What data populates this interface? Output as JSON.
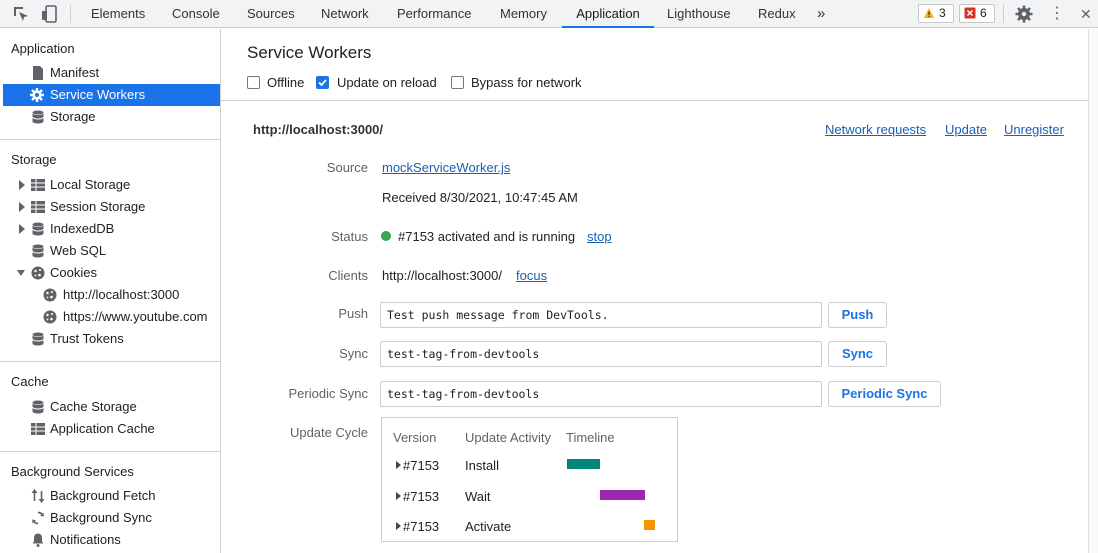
{
  "toolbar": {
    "tabs": [
      "Elements",
      "Console",
      "Sources",
      "Network",
      "Performance",
      "Memory",
      "Application",
      "Lighthouse",
      "Redux"
    ],
    "active_tab": "Application",
    "more_tabs": "»",
    "warnings_count": "3",
    "errors_count": "6",
    "close_glyph": "✕",
    "more_glyph": "⋮"
  },
  "sidebar": {
    "sections": [
      {
        "title": "Application",
        "items": [
          {
            "label": "Manifest",
            "icon": "document-icon"
          },
          {
            "label": "Service Workers",
            "icon": "gear-icon",
            "selected": true
          },
          {
            "label": "Storage",
            "icon": "database-icon"
          }
        ]
      },
      {
        "title": "Storage",
        "items": [
          {
            "label": "Local Storage",
            "icon": "grid-icon",
            "expand": "collapsed"
          },
          {
            "label": "Session Storage",
            "icon": "grid-icon",
            "expand": "collapsed"
          },
          {
            "label": "IndexedDB",
            "icon": "database-icon",
            "expand": "collapsed"
          },
          {
            "label": "Web SQL",
            "icon": "database-icon"
          },
          {
            "label": "Cookies",
            "icon": "cookie-icon",
            "expand": "expanded"
          },
          {
            "label": "http://localhost:3000",
            "icon": "cookie-icon",
            "child": true
          },
          {
            "label": "https://www.youtube.com",
            "icon": "cookie-icon",
            "child": true
          },
          {
            "label": "Trust Tokens",
            "icon": "database-icon"
          }
        ]
      },
      {
        "title": "Cache",
        "items": [
          {
            "label": "Cache Storage",
            "icon": "database-icon"
          },
          {
            "label": "Application Cache",
            "icon": "grid-icon"
          }
        ]
      },
      {
        "title": "Background Services",
        "items": [
          {
            "label": "Background Fetch",
            "icon": "arrows-updown-icon"
          },
          {
            "label": "Background Sync",
            "icon": "sync-icon"
          },
          {
            "label": "Notifications",
            "icon": "bell-icon"
          }
        ]
      }
    ]
  },
  "main": {
    "title": "Service Workers",
    "options": [
      {
        "label": "Offline",
        "checked": false
      },
      {
        "label": "Update on reload",
        "checked": true
      },
      {
        "label": "Bypass for network",
        "checked": false
      }
    ],
    "origin": "http://localhost:3000/",
    "header_links": [
      "Network requests",
      "Update",
      "Unregister"
    ],
    "source_label": "Source",
    "source_file": "mockServiceWorker.js",
    "received": "Received 8/30/2021, 10:47:45 AM",
    "status_label": "Status",
    "status_text": "#7153 activated and is running",
    "status_action": "stop",
    "status_color": "#34a853",
    "clients_label": "Clients",
    "clients_value": "http://localhost:3000/",
    "clients_action": "focus",
    "push_label": "Push",
    "push_value": "Test push message from DevTools.",
    "push_button": "Push",
    "sync_label": "Sync",
    "sync_value": "test-tag-from-devtools",
    "sync_button": "Sync",
    "periodic_label": "Periodic Sync",
    "periodic_value": "test-tag-from-devtools",
    "periodic_button": "Periodic Sync",
    "update_cycle_label": "Update Cycle",
    "update_cycle": {
      "headers": [
        "Version",
        "Update Activity",
        "Timeline"
      ],
      "rows": [
        {
          "version": "#7153",
          "activity": "Install",
          "color": "#00897b"
        },
        {
          "version": "#7153",
          "activity": "Wait",
          "color": "#9c27b0"
        },
        {
          "version": "#7153",
          "activity": "Activate",
          "color": "#f59300"
        }
      ]
    }
  }
}
